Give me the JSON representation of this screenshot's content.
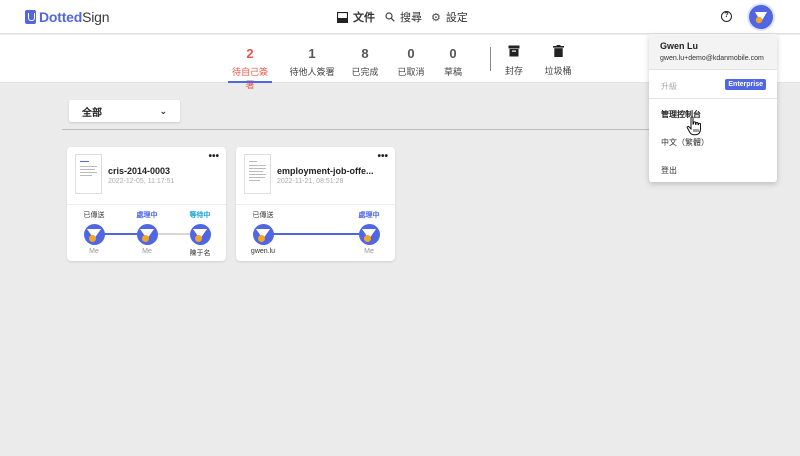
{
  "app": {
    "logo_prefix": "Dotted",
    "logo_suffix": "Sign"
  },
  "nav": {
    "documents": "文件",
    "search": "搜尋",
    "settings": "設定"
  },
  "status_tabs": [
    {
      "count": "2",
      "label": "待自己簽署",
      "active": true
    },
    {
      "count": "1",
      "label": "待他人簽署"
    },
    {
      "count": "8",
      "label": "已完成"
    },
    {
      "count": "0",
      "label": "已取消"
    },
    {
      "count": "0",
      "label": "草稿"
    }
  ],
  "archive_tabs": [
    {
      "label": "封存",
      "icon": "archive-icon"
    },
    {
      "label": "垃圾桶",
      "icon": "trash-icon"
    }
  ],
  "filter": {
    "selected": "全部"
  },
  "cards": [
    {
      "title": "cris-2014-0003",
      "date": "2022-12-05, 11:17:51",
      "steps": [
        {
          "status": "已傳送",
          "name": "Me"
        },
        {
          "status": "處理中",
          "name": "Me"
        },
        {
          "status": "等待中",
          "name": "陳于名"
        }
      ]
    },
    {
      "title": "employment-job-offe...",
      "date": "2022-11-21, 08:51:28",
      "steps": [
        {
          "status": "已傳送",
          "name": "gwen.lu"
        },
        {
          "status": "處理中",
          "name": "Me"
        }
      ]
    }
  ],
  "account_menu": {
    "name": "Gwen Lu",
    "email": "gwen.lu+demo@kdanmobile.com",
    "upgrade": "升級",
    "plan_badge": "Enterprise",
    "admin_console": "管理控制台",
    "language": "中文（繁體）",
    "logout": "登出"
  },
  "colors": {
    "accent": "#5166e3",
    "active_tab": "#e8574a",
    "processing": "#4b67e6",
    "waiting": "#17a2d8"
  }
}
